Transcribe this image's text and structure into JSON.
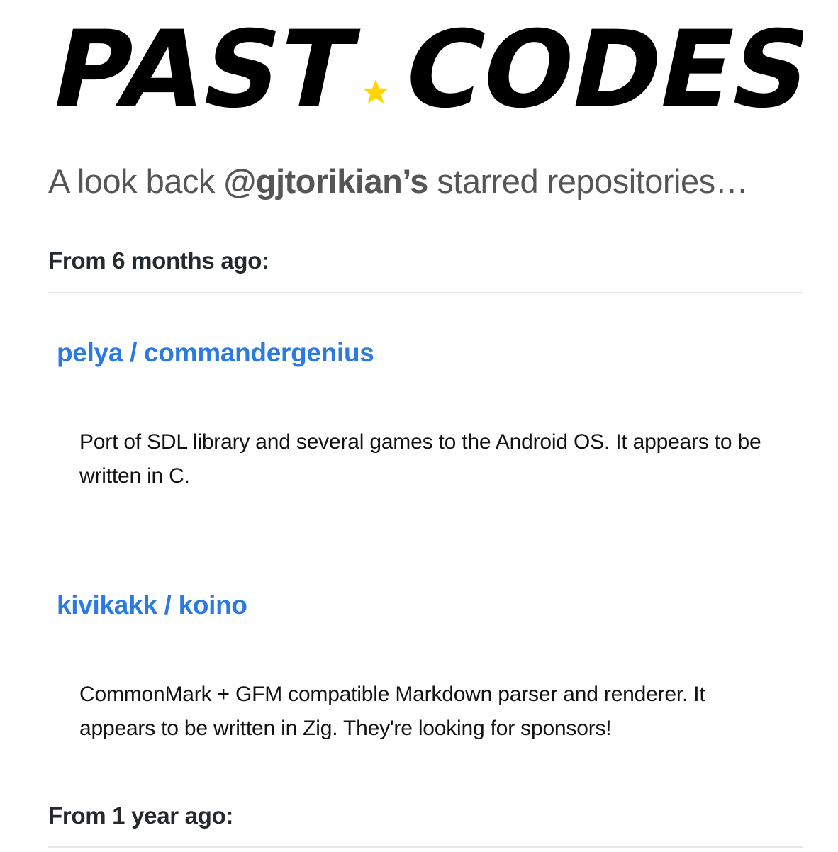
{
  "logo": {
    "left_text": "PAST",
    "right_text": "CODES",
    "star_color": "#FFD500",
    "text_color": "#000000"
  },
  "tagline": {
    "prefix": "A look back ",
    "user": "@gjtorikian’s",
    "suffix": " starred repositories…"
  },
  "sections": [
    {
      "heading": "From 6 months ago:",
      "repos": [
        {
          "name": "pelya / commandergenius",
          "description": "Port of SDL library and several games to the Android OS. It appears to be written in C."
        },
        {
          "name": "kivikakk / koino",
          "description": "CommonMark + GFM compatible Markdown parser and renderer. It appears to be written in Zig. They're looking for sponsors!"
        }
      ]
    },
    {
      "heading": "From 1 year ago:",
      "repos": []
    }
  ],
  "colors": {
    "link": "#2a7ae2",
    "tagline": "#555555",
    "divider": "#e8e8e8"
  }
}
